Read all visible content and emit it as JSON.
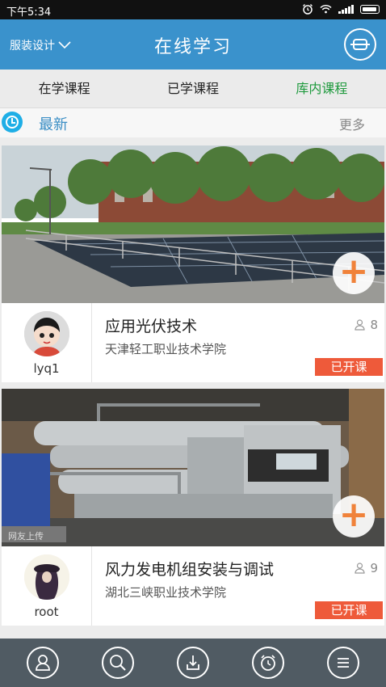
{
  "status_bar": {
    "time": "下午5:34"
  },
  "header": {
    "department": "服装设计",
    "title": "在线学习"
  },
  "tabs": [
    {
      "label": "在学课程",
      "active": false
    },
    {
      "label": "已学课程",
      "active": false
    },
    {
      "label": "库内课程",
      "active": true
    }
  ],
  "section": {
    "label": "最新",
    "more": "更多"
  },
  "courses": [
    {
      "title": "应用光伏技术",
      "school": "天津轻工职业技术学院",
      "user": "lyq1",
      "count": "8",
      "status": "已开课"
    },
    {
      "title": "风力发电机组安装与调试",
      "school": "湖北三峡职业技术学院",
      "user": "root",
      "count": "9",
      "status": "已开课"
    }
  ],
  "nav_icons": [
    "user-icon",
    "search-icon",
    "download-icon",
    "alarm-icon",
    "menu-icon"
  ],
  "colors": {
    "header": "#3a92cc",
    "active_tab": "#1f9a3e",
    "badge": "#ee5a3a",
    "plus": "#f0823a",
    "bottom_bar": "#505b63"
  }
}
